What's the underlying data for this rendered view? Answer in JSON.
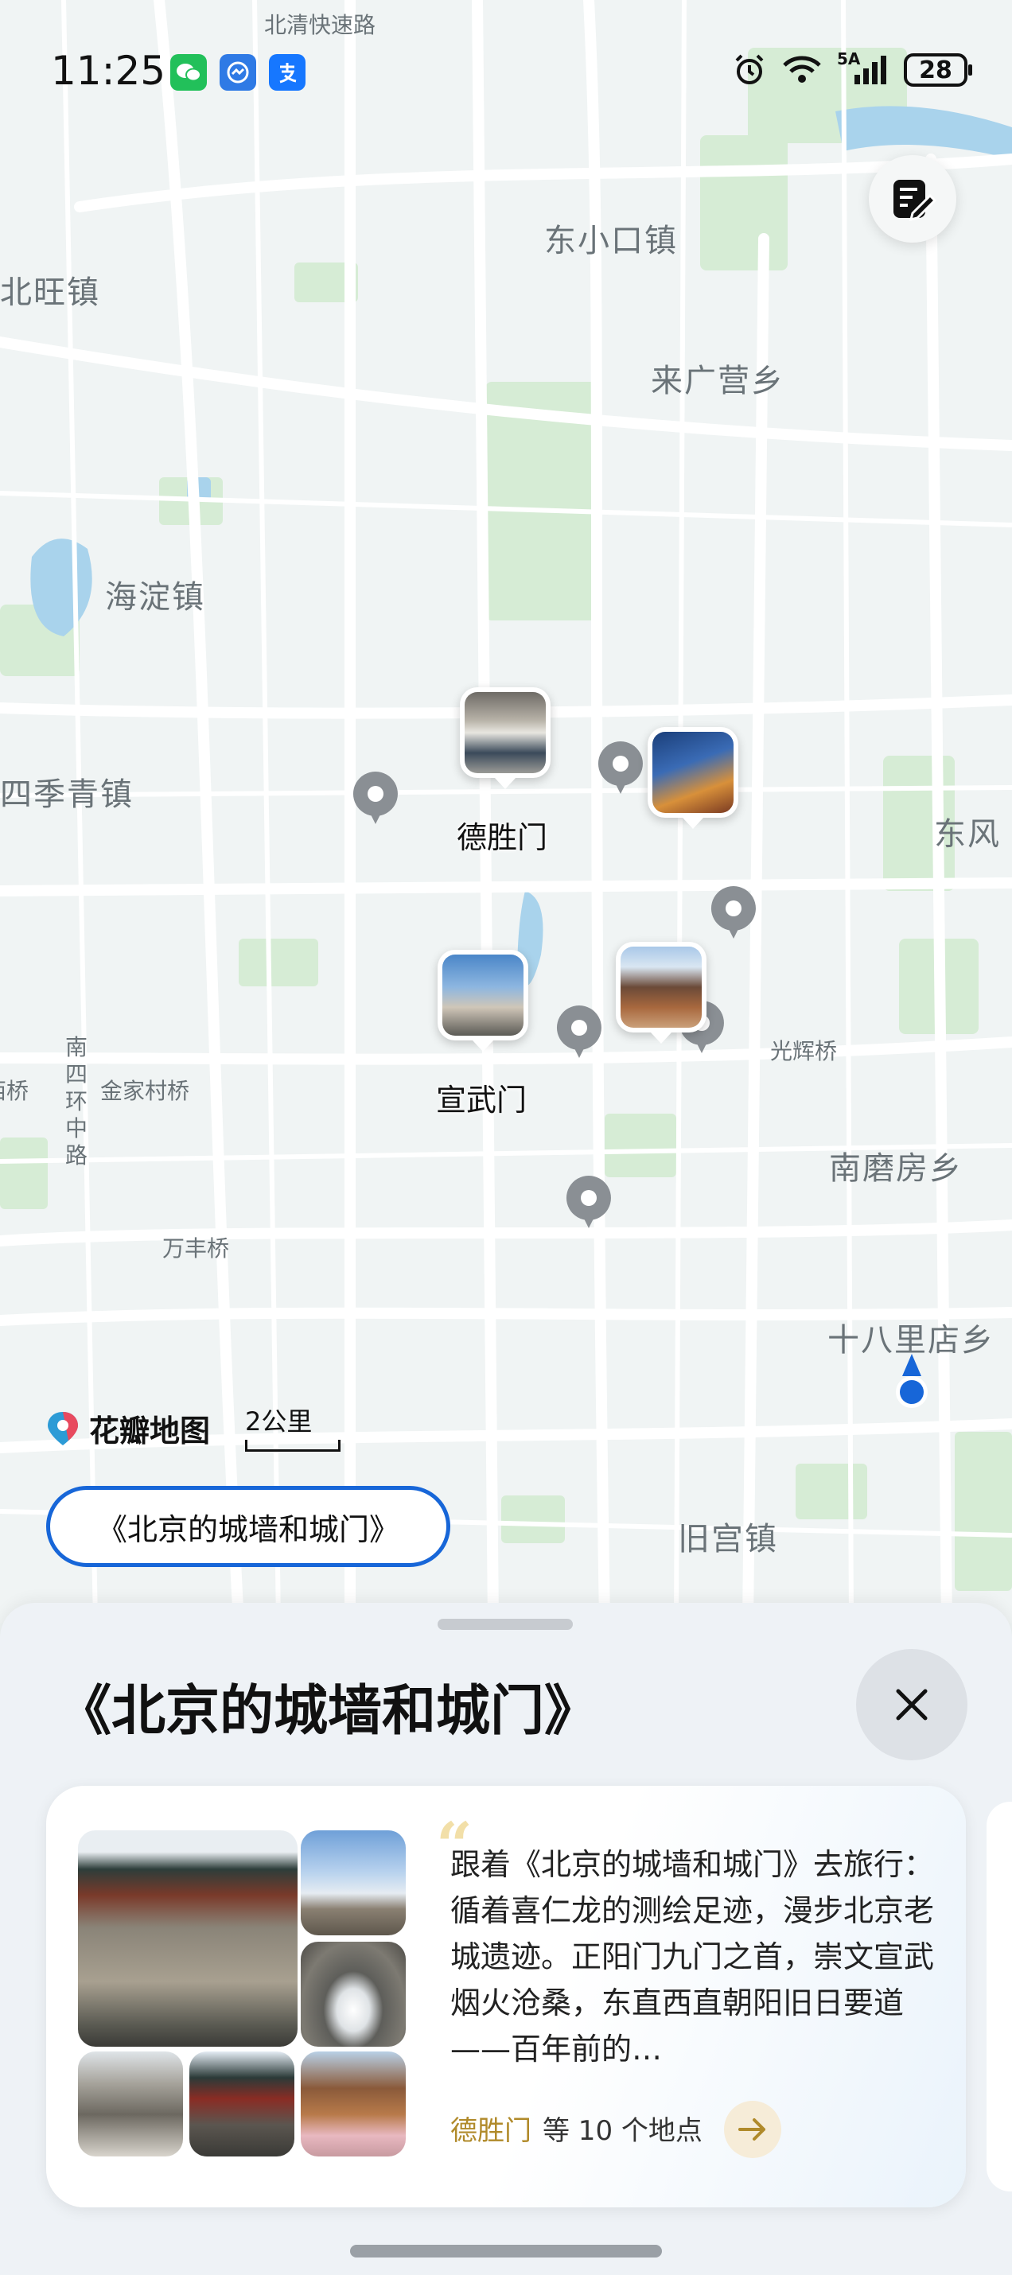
{
  "status_bar": {
    "time": "11:25",
    "apps": [
      "wechat-icon",
      "messages-icon",
      "alipay-icon"
    ],
    "network": "5A",
    "battery": "28"
  },
  "map": {
    "labels": {
      "beiqing_road": "北清快速路",
      "dongxiaokou": "东小口镇",
      "beiwang": "北旺镇",
      "laiguangying": "来广营乡",
      "haidian": "海淀镇",
      "sijiqing": "四季青镇",
      "dongfeng": "东风",
      "guanghui_bridge": "光辉桥",
      "nanmofang": "南磨房乡",
      "south_4th_ring": "南四环中路",
      "jinjiacun_bridge": "金家村桥",
      "xi_bridge": "西桥",
      "wanfeng_bridge": "万丰桥",
      "shibalidian": "十八里店乡",
      "jiugong": "旧宫镇"
    },
    "pins": {
      "deshengmen": "德胜门",
      "xuanwumen": "宣武门"
    },
    "brand": "花瓣地图",
    "scale": "2公里",
    "collection_chip": "《北京的城墙和城门》"
  },
  "sheet": {
    "title": "《北京的城墙和城门》",
    "card": {
      "quote_mark": "“",
      "description": "跟着《北京的城墙和城门》去旅行：循着喜仁龙的测绘足迹，漫步北京老城遗迹。正阳门九门之首，崇文宣武烟火沧桑，东直西直朝阳旧日要道——百年前的…",
      "highlight_place": "德胜门",
      "place_count": "等 10 个地点"
    }
  },
  "colors": {
    "accent_blue": "#1766d8",
    "highlight_gold": "#b08a2a",
    "map_green": "#d5ecd6",
    "map_water": "#a9d3ec"
  }
}
